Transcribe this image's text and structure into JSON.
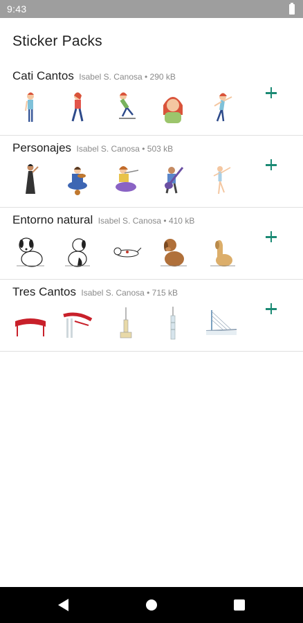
{
  "status_bar": {
    "time": "9:43"
  },
  "app": {
    "title": "Sticker Packs"
  },
  "packs": [
    {
      "name": "Cati Cantos",
      "meta": "Isabel S. Canosa • 290 kB",
      "stickers": [
        "girl-standing-sticker",
        "girl-walking-sticker",
        "girl-skateboard-sticker",
        "girl-portrait-sticker",
        "girl-dancing-sticker"
      ]
    },
    {
      "name": "Personajes",
      "meta": "Isabel S. Canosa • 503 kB",
      "stickers": [
        "woman-dress-sticker",
        "boy-violin-sticker",
        "girl-flute-sticker",
        "boy-guitar-sticker",
        "dancer-sticker"
      ]
    },
    {
      "name": "Entorno natural",
      "meta": "Isabel S. Canosa • 410 kB",
      "stickers": [
        "dog-sitting-sticker",
        "dog-looking-sticker",
        "dog-lying-sticker",
        "brown-dog-sticker",
        "tan-dog-sticker"
      ]
    },
    {
      "name": "Tres Cantos",
      "meta": "Isabel S. Canosa • 715 kB",
      "stickers": [
        "red-sign-sticker",
        "red-arch-sticker",
        "tower-sticker",
        "tall-tower-sticker",
        "bridge-sticker"
      ]
    }
  ],
  "colors": {
    "accent": "#1b8a74",
    "status_bar": "#9e9e9e",
    "divider": "#e0e0e0"
  },
  "nav": {
    "icons": [
      "back-icon",
      "home-icon",
      "recents-icon"
    ]
  }
}
